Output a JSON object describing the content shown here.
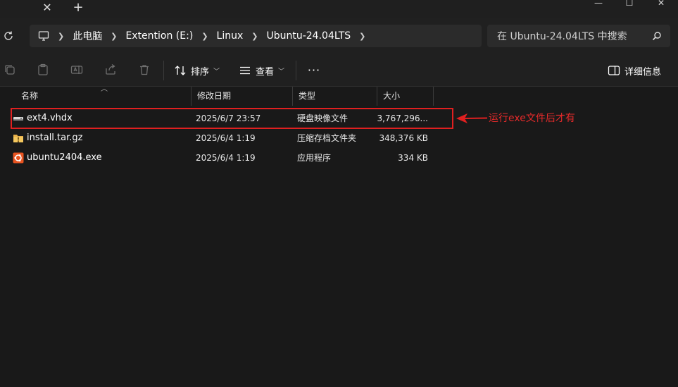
{
  "window": {
    "tab_close_glyph": "✕",
    "tab_new_glyph": "+",
    "min_glyph": "—",
    "max_glyph": "☐",
    "close_glyph": "✕"
  },
  "breadcrumb": [
    "此电脑",
    "Extention (E:)",
    "Linux",
    "Ubuntu-24.04LTS"
  ],
  "search": {
    "placeholder": "在 Ubuntu-24.04LTS 中搜索"
  },
  "toolbar": {
    "sort_label": "排序",
    "view_label": "查看",
    "more_label": "···",
    "details_label": "详细信息"
  },
  "columns": {
    "name": "名称",
    "date": "修改日期",
    "type": "类型",
    "size": "大小"
  },
  "files": [
    {
      "name": "ext4.vhdx",
      "date": "2025/6/7 23:57",
      "type": "硬盘映像文件",
      "size": "3,767,296...",
      "icon": "vhdx-disk-icon"
    },
    {
      "name": "install.tar.gz",
      "date": "2025/6/4 1:19",
      "type": "压缩存档文件夹",
      "size": "348,376 KB",
      "icon": "zip-folder-icon"
    },
    {
      "name": "ubuntu2404.exe",
      "date": "2025/6/4 1:19",
      "type": "应用程序",
      "size": "334 KB",
      "icon": "ubuntu-app-icon"
    }
  ],
  "annotation": {
    "text": "运行exe文件后才有",
    "color": "#e52a2a"
  },
  "colors": {
    "background": "#191919",
    "bar": "#202020",
    "highlight": "#e02020"
  }
}
